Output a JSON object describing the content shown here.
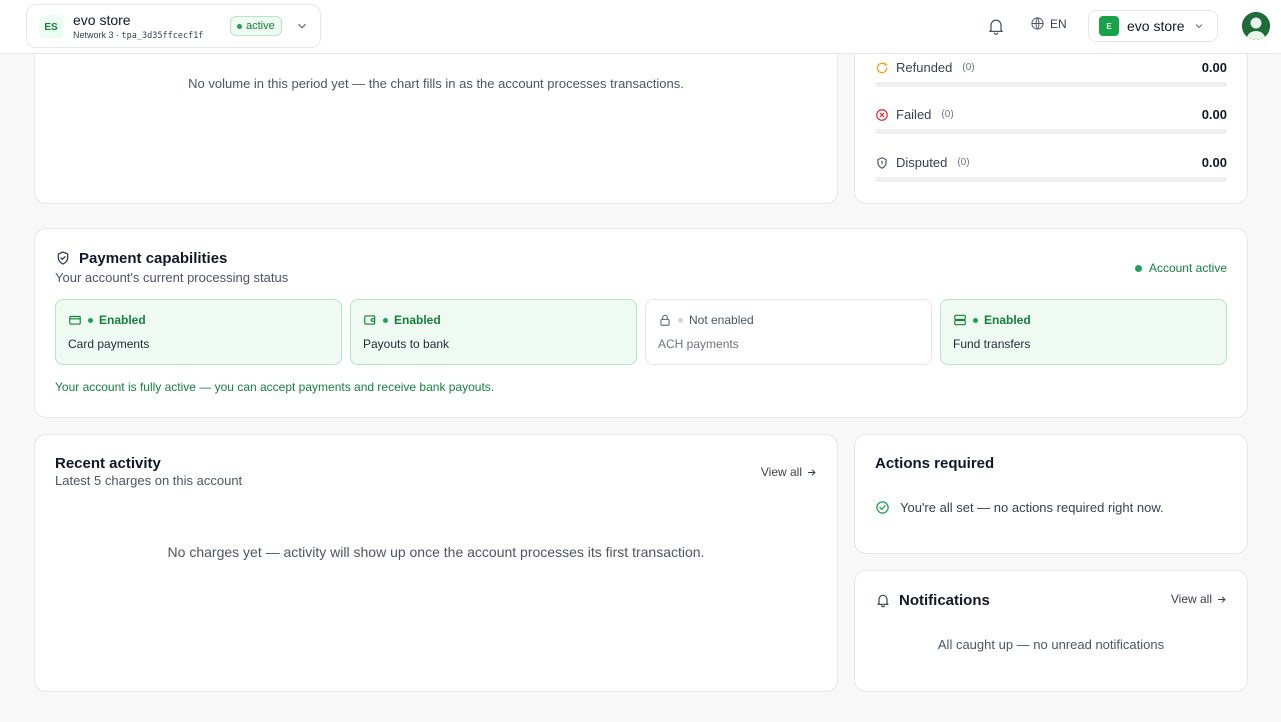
{
  "header": {
    "store_badge": "ES",
    "store_name": "evo store",
    "network": "Network 3",
    "separator": "·",
    "account_id": "tpa_3d35ffcecf1f",
    "status": "active",
    "language": "EN",
    "account_badge": "E",
    "account_name": "evo store",
    "icons": [
      "chevron-down-icon",
      "bell-icon",
      "globe-icon",
      "avatar"
    ]
  },
  "volume": {
    "empty_message": "No volume in this period yet — the chart fills in as the account processes transactions."
  },
  "breakdown": {
    "rows": [
      {
        "label": "Refunded",
        "count": "(0)",
        "amount": "0.00",
        "share": 0,
        "icon": "refund-icon"
      },
      {
        "label": "Failed",
        "count": "(0)",
        "amount": "0.00",
        "share": 0,
        "icon": "x-circle-icon"
      },
      {
        "label": "Disputed",
        "count": "(0)",
        "amount": "0.00",
        "share": 0,
        "icon": "shield-icon"
      }
    ]
  },
  "capabilities": {
    "title": "Payment capabilities",
    "subtitle": "Your account's current processing status",
    "account_status": "Account active",
    "tiles": [
      {
        "state": "Enabled",
        "name": "Card payments",
        "enabled": true,
        "icon": "card-icon"
      },
      {
        "state": "Enabled",
        "name": "Payouts to bank",
        "enabled": true,
        "icon": "wallet-icon"
      },
      {
        "state": "Not enabled",
        "name": "ACH payments",
        "enabled": false,
        "icon": "lock-icon"
      },
      {
        "state": "Enabled",
        "name": "Fund transfers",
        "enabled": true,
        "icon": "transfer-icon"
      }
    ],
    "note": "Your account is fully active — you can accept payments and receive bank payouts."
  },
  "activity": {
    "title": "Recent activity",
    "subtitle": "Latest 5 charges on this account",
    "view_all": "View all",
    "empty_message": "No charges yet — activity will show up once the account processes its first transaction."
  },
  "actions": {
    "title": "Actions required",
    "message": "You're all set — no actions required right now."
  },
  "notifications": {
    "title": "Notifications",
    "view_all": "View all",
    "message": "All caught up — no unread notifications"
  },
  "colors": {
    "accent": "#15803d",
    "accent_bg": "#effaf3",
    "accent_border": "#b7e4c7",
    "danger": "#dc2626",
    "warning": "#f59e0b"
  }
}
